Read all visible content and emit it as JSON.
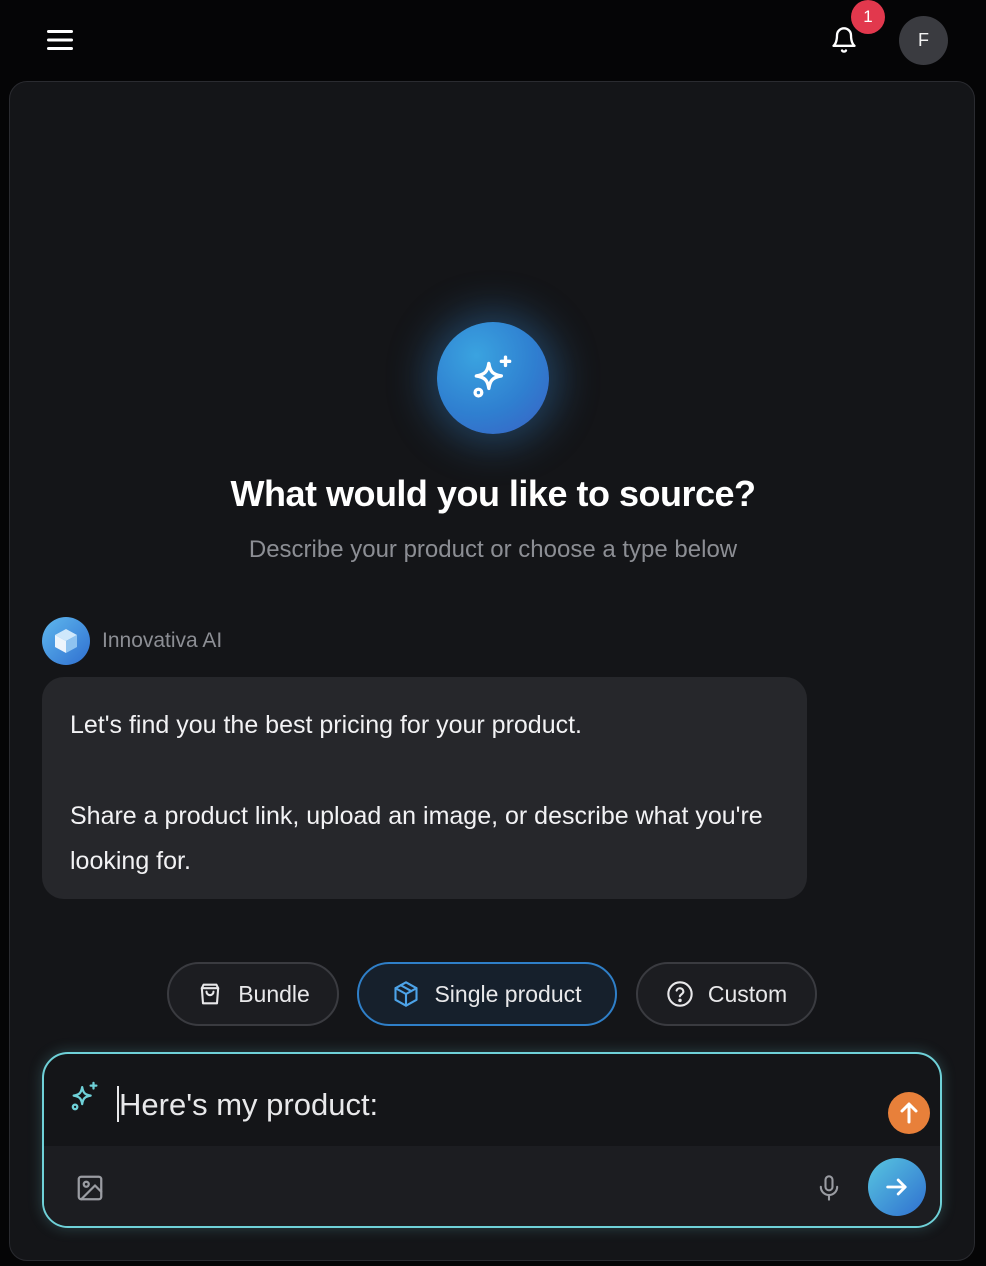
{
  "header": {
    "menu_icon": "hamburger-menu-icon",
    "bell_icon": "bell-icon",
    "notification_count": "1",
    "avatar_initial": "F"
  },
  "hero": {
    "icon": "sparkles-icon",
    "title": "What would you like to source?",
    "subtitle": "Describe your product or choose a type below"
  },
  "message": {
    "sender": "Innovativa AI",
    "avatar_icon": "cube-icon",
    "line1": "Let's find you the best pricing for your product.",
    "line2": "Share a product link, upload an image, or describe what you're looking for."
  },
  "chips": [
    {
      "label": "Bundle",
      "icon": "shopping-bag-icon",
      "active": false
    },
    {
      "label": "Single product",
      "icon": "package-icon",
      "active": true
    },
    {
      "label": "Custom",
      "icon": "question-circle-icon",
      "active": false
    }
  ],
  "composer": {
    "value": "Here's my product:",
    "icons": [
      "sparkles-icon",
      "upload-arrow-icon",
      "image-icon",
      "microphone-icon",
      "send-arrow-icon"
    ]
  },
  "colors": {
    "accent": "#2f7fd0",
    "composer_border": "#6fd1d8",
    "badge": "#e2384d",
    "upload": "#e8803a"
  }
}
